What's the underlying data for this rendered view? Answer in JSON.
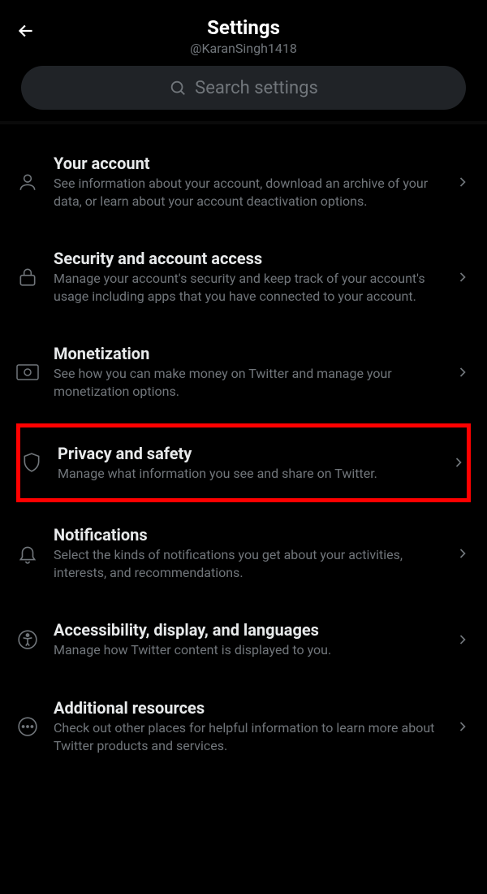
{
  "header": {
    "title": "Settings",
    "username": "@KaranSingh1418"
  },
  "search": {
    "placeholder": "Search settings"
  },
  "settings": [
    {
      "title": "Your account",
      "desc": "See information about your account, download an archive of your data, or learn about your account deactivation options."
    },
    {
      "title": "Security and account access",
      "desc": "Manage your account's security and keep track of your account's usage including apps that you have connected to your account."
    },
    {
      "title": "Monetization",
      "desc": "See how you can make money on Twitter and manage your monetization options."
    },
    {
      "title": "Privacy and safety",
      "desc": "Manage what information you see and share on Twitter."
    },
    {
      "title": "Notifications",
      "desc": "Select the kinds of notifications you get about your activities, interests, and recommendations."
    },
    {
      "title": "Accessibility, display, and languages",
      "desc": "Manage how Twitter content is displayed to you."
    },
    {
      "title": "Additional resources",
      "desc": "Check out other places for helpful information to learn more about Twitter products and services."
    }
  ]
}
